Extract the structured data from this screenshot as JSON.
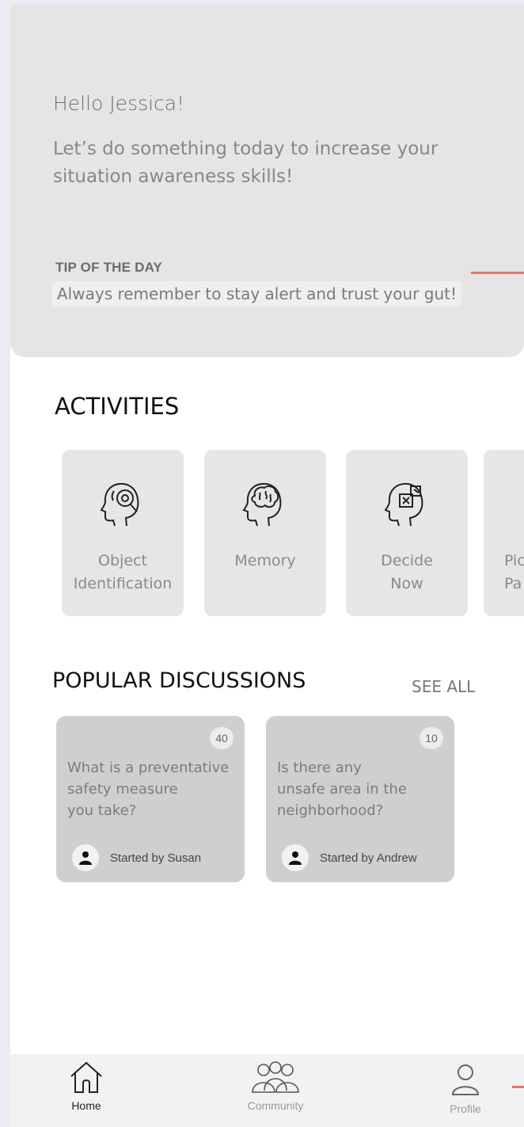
{
  "hero": {
    "greeting": "Hello Jessica!",
    "subtitle": "Let’s do something today to increase your situation awareness skills!",
    "tip_title": "TIP OF THE DAY",
    "tip_text": "Always remember to stay alert and trust your gut!"
  },
  "activities": {
    "title": "ACTIVITIES",
    "items": [
      {
        "label": "Object\nIdentification",
        "icon": "head-magnifier-icon"
      },
      {
        "label": "Memory",
        "icon": "head-brain-icon"
      },
      {
        "label": "Decide\nNow",
        "icon": "head-puzzle-icon"
      },
      {
        "label": "Pic\nPa",
        "icon": "head-icon"
      }
    ]
  },
  "discussions": {
    "title": "POPULAR DISCUSSIONS",
    "see_all": "SEE ALL",
    "items": [
      {
        "count": "40",
        "question": "What is a preventative\nsafety measure\n you take?",
        "author": "Started by Susan"
      },
      {
        "count": "10",
        "question": "Is there any\nunsafe area in the\nneighborhood?",
        "author": "Started by Andrew"
      }
    ]
  },
  "nav": {
    "home": "Home",
    "community": "Community",
    "profile": "Profile"
  },
  "colors": {
    "accent": "#e0766c",
    "hero_bg": "#e5e5e5",
    "card_bg": "#e6e6e6",
    "discussion_bg": "#cfcfcf"
  }
}
